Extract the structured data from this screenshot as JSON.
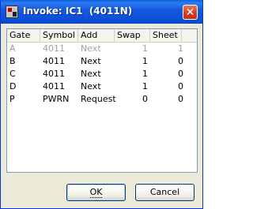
{
  "window": {
    "title": "Invoke: IC1  (4011N)",
    "close_symbol": "✕"
  },
  "list": {
    "columns": [
      "Gate",
      "Symbol",
      "Add",
      "Swap",
      "Sheet"
    ],
    "rows": [
      {
        "gate": "A",
        "symbol": "4011",
        "add": "Next",
        "swap": "1",
        "sheet": "1",
        "disabled": true
      },
      {
        "gate": "B",
        "symbol": "4011",
        "add": "Next",
        "swap": "1",
        "sheet": "0",
        "disabled": false
      },
      {
        "gate": "C",
        "symbol": "4011",
        "add": "Next",
        "swap": "1",
        "sheet": "0",
        "disabled": false
      },
      {
        "gate": "D",
        "symbol": "4011",
        "add": "Next",
        "swap": "1",
        "sheet": "0",
        "disabled": false
      },
      {
        "gate": "P",
        "symbol": "PWRN",
        "add": "Request",
        "swap": "0",
        "sheet": "0",
        "disabled": false
      }
    ]
  },
  "buttons": {
    "ok": "OK",
    "cancel": "Cancel"
  },
  "colors": {
    "titlebar": "#0a4fd8",
    "close": "#d6432a",
    "dialog_bg": "#ece9d8",
    "disabled_text": "#a0a0a0"
  },
  "icons": {
    "app": "app-icon",
    "close": "close-icon"
  }
}
